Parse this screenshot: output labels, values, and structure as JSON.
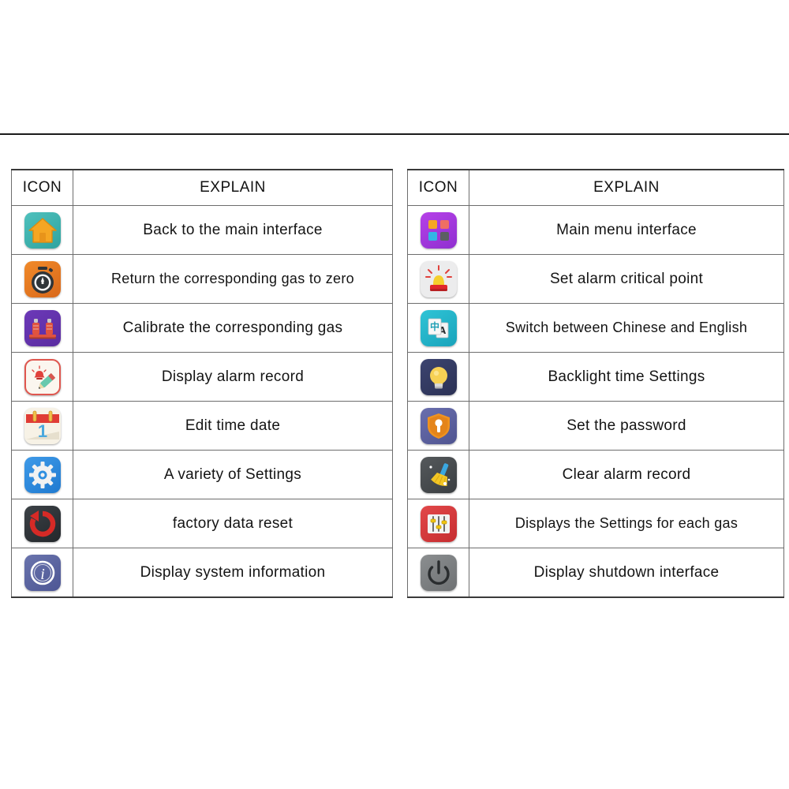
{
  "page": {
    "background": "#ffffff",
    "divider_color": "#1b1b1b"
  },
  "tables": [
    {
      "id": "left-table",
      "headers": {
        "icon": "ICON",
        "explain": "EXPLAIN"
      },
      "rows": [
        {
          "icon_name": "home-icon",
          "icon_colors": {
            "bg": "#3fb3af",
            "fg": "#f5a623"
          },
          "explain": "Back to the main interface"
        },
        {
          "icon_name": "stopwatch-zero-icon",
          "icon_colors": {
            "bg": "#e4791f",
            "fg": "#2f3438"
          },
          "explain": "Return the corresponding gas to zero"
        },
        {
          "icon_name": "gas-calibration-icon",
          "icon_colors": {
            "bg": "#6233ad",
            "fg": "#e0533f"
          },
          "explain": "Calibrate the corresponding gas"
        },
        {
          "icon_name": "alarm-record-icon",
          "icon_colors": {
            "bg": "#fbf6ef",
            "fg": "#e0564e"
          },
          "explain": "Display alarm record"
        },
        {
          "icon_name": "calendar-icon",
          "icon_colors": {
            "bg": "#f7f2e6",
            "fg": "#e03c35"
          },
          "explain": "Edit time date"
        },
        {
          "icon_name": "gear-icon",
          "icon_colors": {
            "bg": "#2f8fe0",
            "fg": "#f2f2f2"
          },
          "explain": "A variety of Settings"
        },
        {
          "icon_name": "reset-arrow-icon",
          "icon_colors": {
            "bg": "#2c3034",
            "fg": "#d62a26"
          },
          "explain": "factory data reset"
        },
        {
          "icon_name": "info-icon",
          "icon_colors": {
            "bg": "#5a639f",
            "fg": "#ffffff"
          },
          "explain": "Display system information"
        }
      ]
    },
    {
      "id": "right-table",
      "headers": {
        "icon": "ICON",
        "explain": "EXPLAIN"
      },
      "rows": [
        {
          "icon_name": "grid-menu-icon",
          "icon_colors": {
            "bg": "#a637dd",
            "fg": "#f5a623"
          },
          "explain": "Main menu interface"
        },
        {
          "icon_name": "alarm-light-icon",
          "icon_colors": {
            "bg": "#ececed",
            "fg": "#f5cf2e"
          },
          "explain": "Set alarm critical point"
        },
        {
          "icon_name": "language-switch-icon",
          "icon_colors": {
            "bg": "#22b4ca",
            "fg": "#ffffff"
          },
          "explain": "Switch between Chinese and English"
        },
        {
          "icon_name": "lightbulb-icon",
          "icon_colors": {
            "bg": "#333a61",
            "fg": "#f7d154"
          },
          "explain": "Backlight time Settings"
        },
        {
          "icon_name": "shield-key-icon",
          "icon_colors": {
            "bg": "#5a5f9e",
            "fg": "#f0931f"
          },
          "explain": "Set the password"
        },
        {
          "icon_name": "broom-icon",
          "icon_colors": {
            "bg": "#46494c",
            "fg": "#f3c623"
          },
          "explain": "Clear alarm record"
        },
        {
          "icon_name": "sliders-icon",
          "icon_colors": {
            "bg": "#d33a3c",
            "fg": "#f1c40f"
          },
          "explain": "Displays the Settings for each gas"
        },
        {
          "icon_name": "power-icon",
          "icon_colors": {
            "bg": "#7c7f81",
            "fg": "#2a2d2f"
          },
          "explain": "Display shutdown interface"
        }
      ]
    }
  ]
}
